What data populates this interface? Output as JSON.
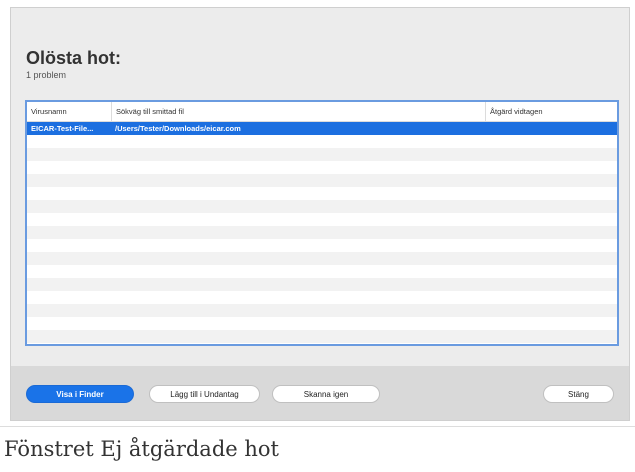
{
  "window": {
    "title": "Olösta hot:",
    "subtitle": "1 problem"
  },
  "table": {
    "columns": [
      "Virusnamn",
      "Sökväg till smittad fil",
      "Åtgärd vidtagen"
    ],
    "rows": [
      {
        "virus": "EICAR-Test-File...",
        "path": "/Users/Tester/Downloads/eicar.com",
        "action": ""
      }
    ]
  },
  "buttons": {
    "show_in_finder": "Visa i Finder",
    "add_to_exclusions": "Lägg till i Undantag",
    "scan_again": "Skanna igen",
    "close": "Stäng"
  },
  "colors": {
    "selection": "#1c6fe0",
    "primary_button": "#1a73e8",
    "table_border": "#6a9be0"
  },
  "caption": "Fönstret Ej åtgärdade hot"
}
